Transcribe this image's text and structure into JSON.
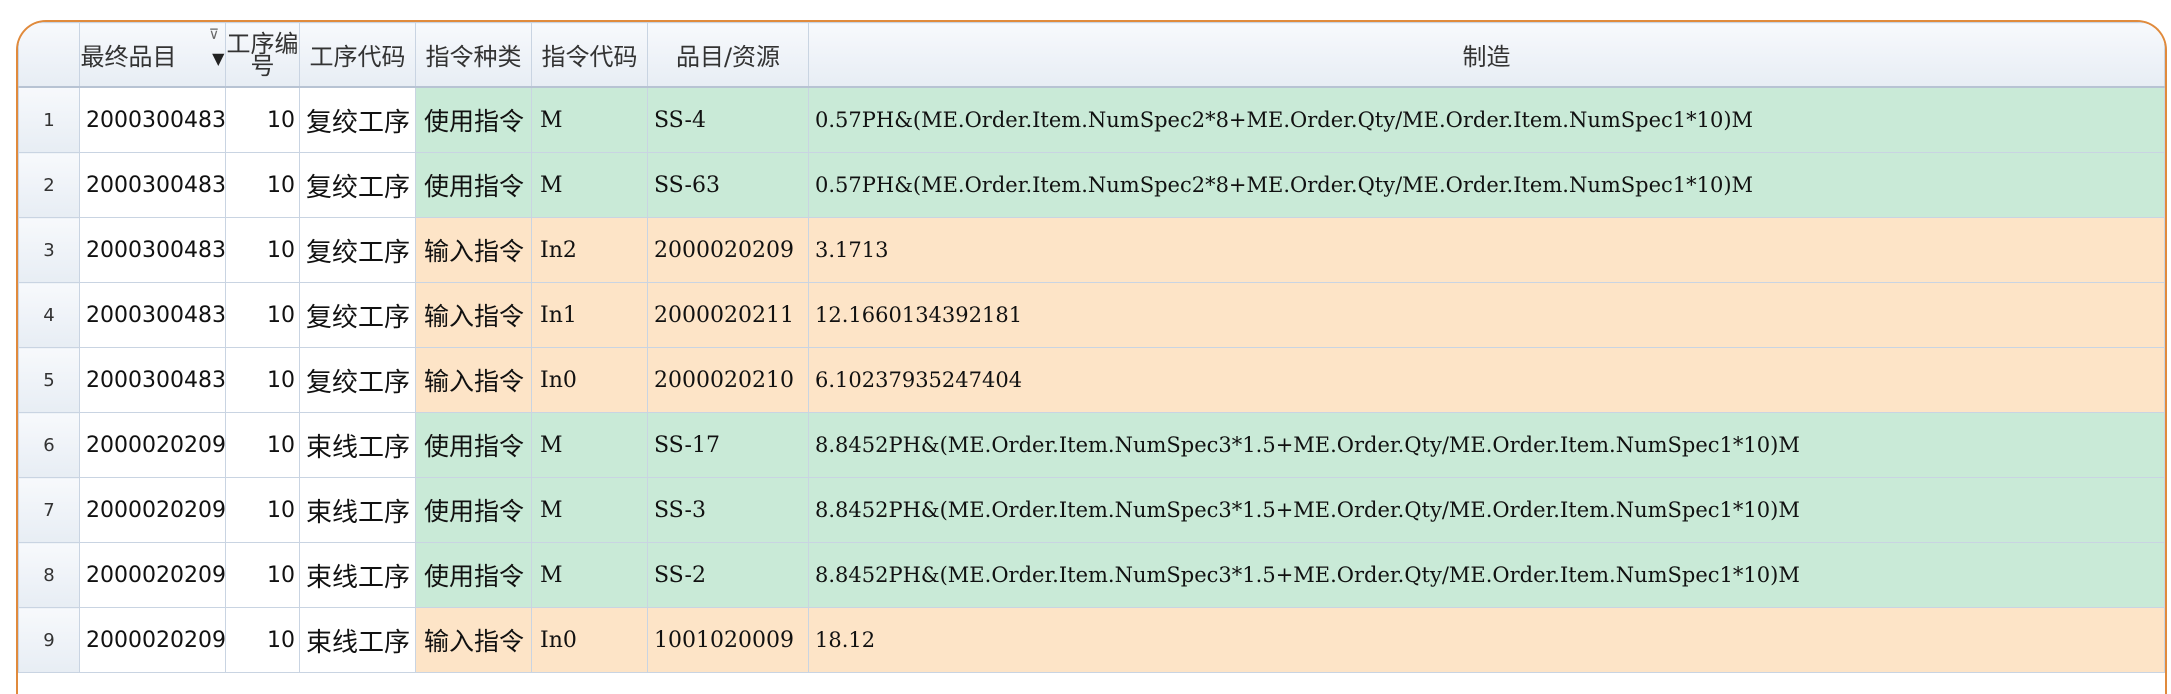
{
  "columns": {
    "final_item": "最终品目",
    "seq_line1": "工序编",
    "seq_line2": "号",
    "op_code": "工序代码",
    "instr_kind": "指令种类",
    "instr_code": "指令代码",
    "item_resource": "品目/资源",
    "make": "制造"
  },
  "icons": {
    "sort": "sort-desc-caret-icon",
    "filter": "filter-icon"
  },
  "colors": {
    "use_row": "#c9ead7",
    "input_row": "#fde4c7",
    "frame": "#e08a3c"
  },
  "rows": [
    {
      "num": "1",
      "final_item": "2000300483",
      "seq": "10",
      "op_code": "复绞工序",
      "instr_kind": "使用指令",
      "instr_code": "M",
      "item_resource": "SS-4",
      "make": "0.57PH&(ME.Order.Item.NumSpec2*8+ME.Order.Qty/ME.Order.Item.NumSpec1*10)M"
    },
    {
      "num": "2",
      "final_item": "2000300483",
      "seq": "10",
      "op_code": "复绞工序",
      "instr_kind": "使用指令",
      "instr_code": "M",
      "item_resource": "SS-63",
      "make": "0.57PH&(ME.Order.Item.NumSpec2*8+ME.Order.Qty/ME.Order.Item.NumSpec1*10)M"
    },
    {
      "num": "3",
      "final_item": "2000300483",
      "seq": "10",
      "op_code": "复绞工序",
      "instr_kind": "输入指令",
      "instr_code": "In2",
      "item_resource": "2000020209",
      "make": "3.1713"
    },
    {
      "num": "4",
      "final_item": "2000300483",
      "seq": "10",
      "op_code": "复绞工序",
      "instr_kind": "输入指令",
      "instr_code": "In1",
      "item_resource": "2000020211",
      "make": "12.1660134392181"
    },
    {
      "num": "5",
      "final_item": "2000300483",
      "seq": "10",
      "op_code": "复绞工序",
      "instr_kind": "输入指令",
      "instr_code": "In0",
      "item_resource": "2000020210",
      "make": "6.10237935247404"
    },
    {
      "num": "6",
      "final_item": "2000020209",
      "seq": "10",
      "op_code": "束线工序",
      "instr_kind": "使用指令",
      "instr_code": "M",
      "item_resource": "SS-17",
      "make": "8.8452PH&(ME.Order.Item.NumSpec3*1.5+ME.Order.Qty/ME.Order.Item.NumSpec1*10)M"
    },
    {
      "num": "7",
      "final_item": "2000020209",
      "seq": "10",
      "op_code": "束线工序",
      "instr_kind": "使用指令",
      "instr_code": "M",
      "item_resource": "SS-3",
      "make": "8.8452PH&(ME.Order.Item.NumSpec3*1.5+ME.Order.Qty/ME.Order.Item.NumSpec1*10)M"
    },
    {
      "num": "8",
      "final_item": "2000020209",
      "seq": "10",
      "op_code": "束线工序",
      "instr_kind": "使用指令",
      "instr_code": "M",
      "item_resource": "SS-2",
      "make": "8.8452PH&(ME.Order.Item.NumSpec3*1.5+ME.Order.Qty/ME.Order.Item.NumSpec1*10)M"
    },
    {
      "num": "9",
      "final_item": "2000020209",
      "seq": "10",
      "op_code": "束线工序",
      "instr_kind": "输入指令",
      "instr_code": "In0",
      "item_resource": "1001020009",
      "make": "18.12"
    }
  ]
}
